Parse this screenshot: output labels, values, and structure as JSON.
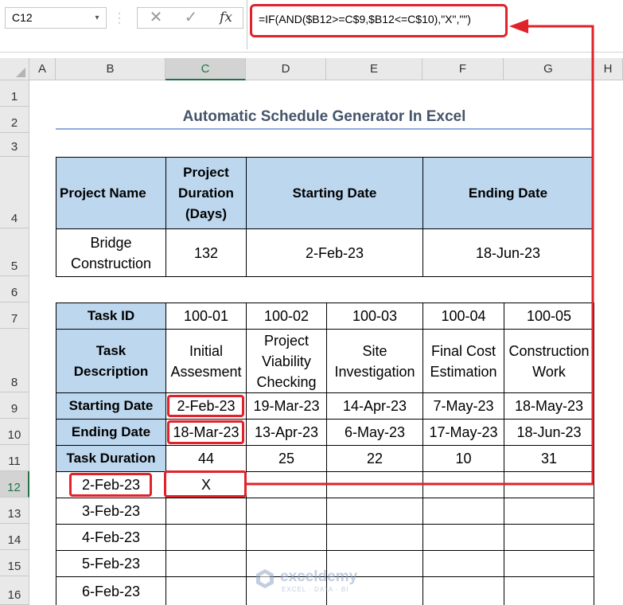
{
  "formula_bar": {
    "name_box": "C12",
    "name_box_arrow": "▾",
    "cancel_symbol": "✕",
    "enter_symbol": "✓",
    "fx_symbol": "fx",
    "formula": "=IF(AND($B12>=C$9,$B12<=C$10),\"X\",\"\")"
  },
  "columns": [
    "A",
    "B",
    "C",
    "D",
    "E",
    "F",
    "G",
    "H"
  ],
  "rows": [
    "1",
    "2",
    "3",
    "4",
    "5",
    "6",
    "7",
    "8",
    "9",
    "10",
    "11",
    "12",
    "13",
    "14",
    "15",
    "16"
  ],
  "sheet": {
    "title": "Automatic Schedule Generator In Excel",
    "project_table": {
      "headers": [
        "Project Name",
        "Project Duration (Days)",
        "Starting Date",
        "Ending Date"
      ],
      "values": [
        "Bridge Construction",
        "132",
        "2-Feb-23",
        "18-Jun-23"
      ]
    },
    "task_table": {
      "row_labels": [
        "Task ID",
        "Task Description",
        "Starting Date",
        "Ending Date",
        "Task Duration"
      ],
      "task_ids": [
        "100-01",
        "100-02",
        "100-03",
        "100-04",
        "100-05"
      ],
      "descriptions": [
        "Initial Assesment",
        "Project Viability Checking",
        "Site Investigation",
        "Final Cost Estimation",
        "Construction Work"
      ],
      "start_dates": [
        "2-Feb-23",
        "19-Mar-23",
        "14-Apr-23",
        "7-May-23",
        "18-May-23"
      ],
      "end_dates": [
        "18-Mar-23",
        "13-Apr-23",
        "6-May-23",
        "17-May-23",
        "18-Jun-23"
      ],
      "durations": [
        "44",
        "25",
        "22",
        "10",
        "31"
      ]
    },
    "schedule": {
      "dates": [
        "2-Feb-23",
        "3-Feb-23",
        "4-Feb-23",
        "5-Feb-23",
        "6-Feb-23"
      ],
      "c12_value": "X"
    }
  },
  "watermark": {
    "name": "exceldemy",
    "tagline": "EXCEL · DATA · BI"
  },
  "colors": {
    "header_fill": "#bdd7ee",
    "highlight": "#e0222a",
    "title": "#44546a",
    "selection": "#217346"
  }
}
